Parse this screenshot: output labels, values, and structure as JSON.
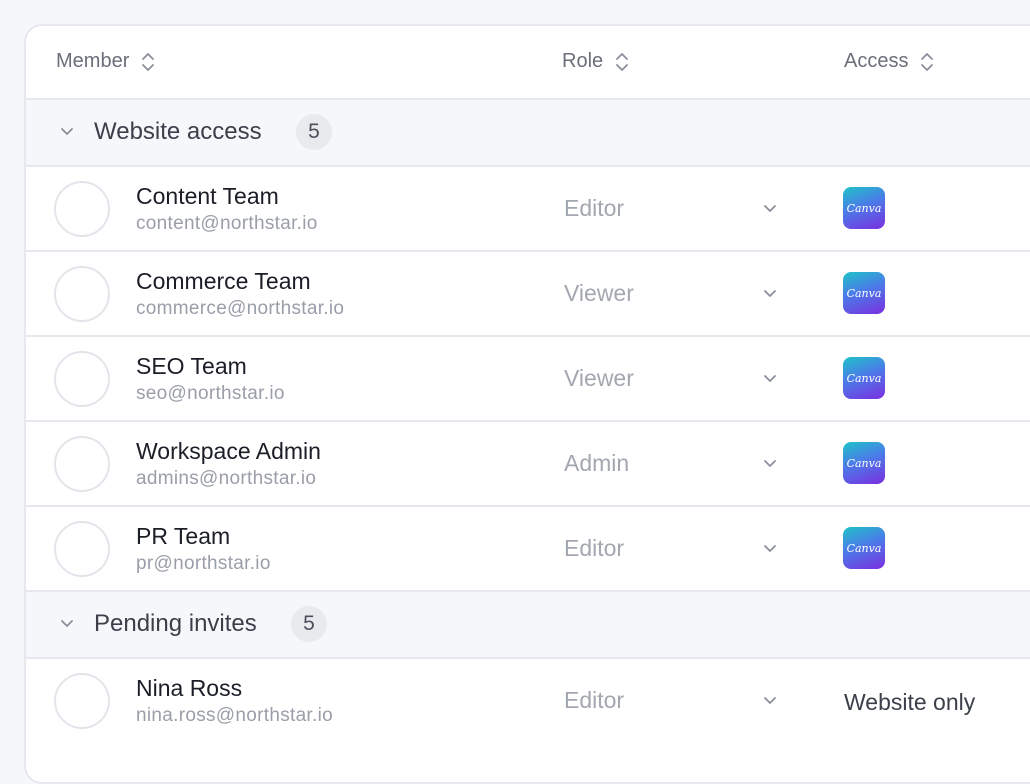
{
  "table": {
    "columns": [
      {
        "label": "Member",
        "icon": "sort-icon"
      },
      {
        "label": "Role",
        "icon": "sort-icon"
      },
      {
        "label": "Access",
        "icon": "sort-icon"
      }
    ]
  },
  "groups": [
    {
      "title": "Website access",
      "count": "5",
      "expanded": true,
      "rows": [
        {
          "name": "Content Team",
          "email": "content@northstar.io",
          "role": "Editor",
          "access_app": "Canva"
        },
        {
          "name": "Commerce Team",
          "email": "commerce@northstar.io",
          "role": "Viewer",
          "access_app": "Canva"
        },
        {
          "name": "SEO Team",
          "email": "seo@northstar.io",
          "role": "Viewer",
          "access_app": "Canva"
        },
        {
          "name": "Workspace Admin",
          "email": "admins@northstar.io",
          "role": "Admin",
          "access_app": "Canva"
        },
        {
          "name": "PR Team",
          "email": "pr@northstar.io",
          "role": "Editor",
          "access_app": "Canva"
        }
      ]
    },
    {
      "title": "Pending invites",
      "count": "5",
      "expanded": true,
      "rows": [
        {
          "name": "Nina Ross",
          "email": "nina.ross@northstar.io",
          "role": "Editor",
          "access_text": "Website only"
        }
      ]
    }
  ],
  "colors": {
    "border": "#e6e8ee",
    "group_bg": "#f6f7fa",
    "muted_text": "#a3a7b0",
    "canva_gradient_start": "#1fc3c8",
    "canva_gradient_end": "#7a2fe0"
  }
}
